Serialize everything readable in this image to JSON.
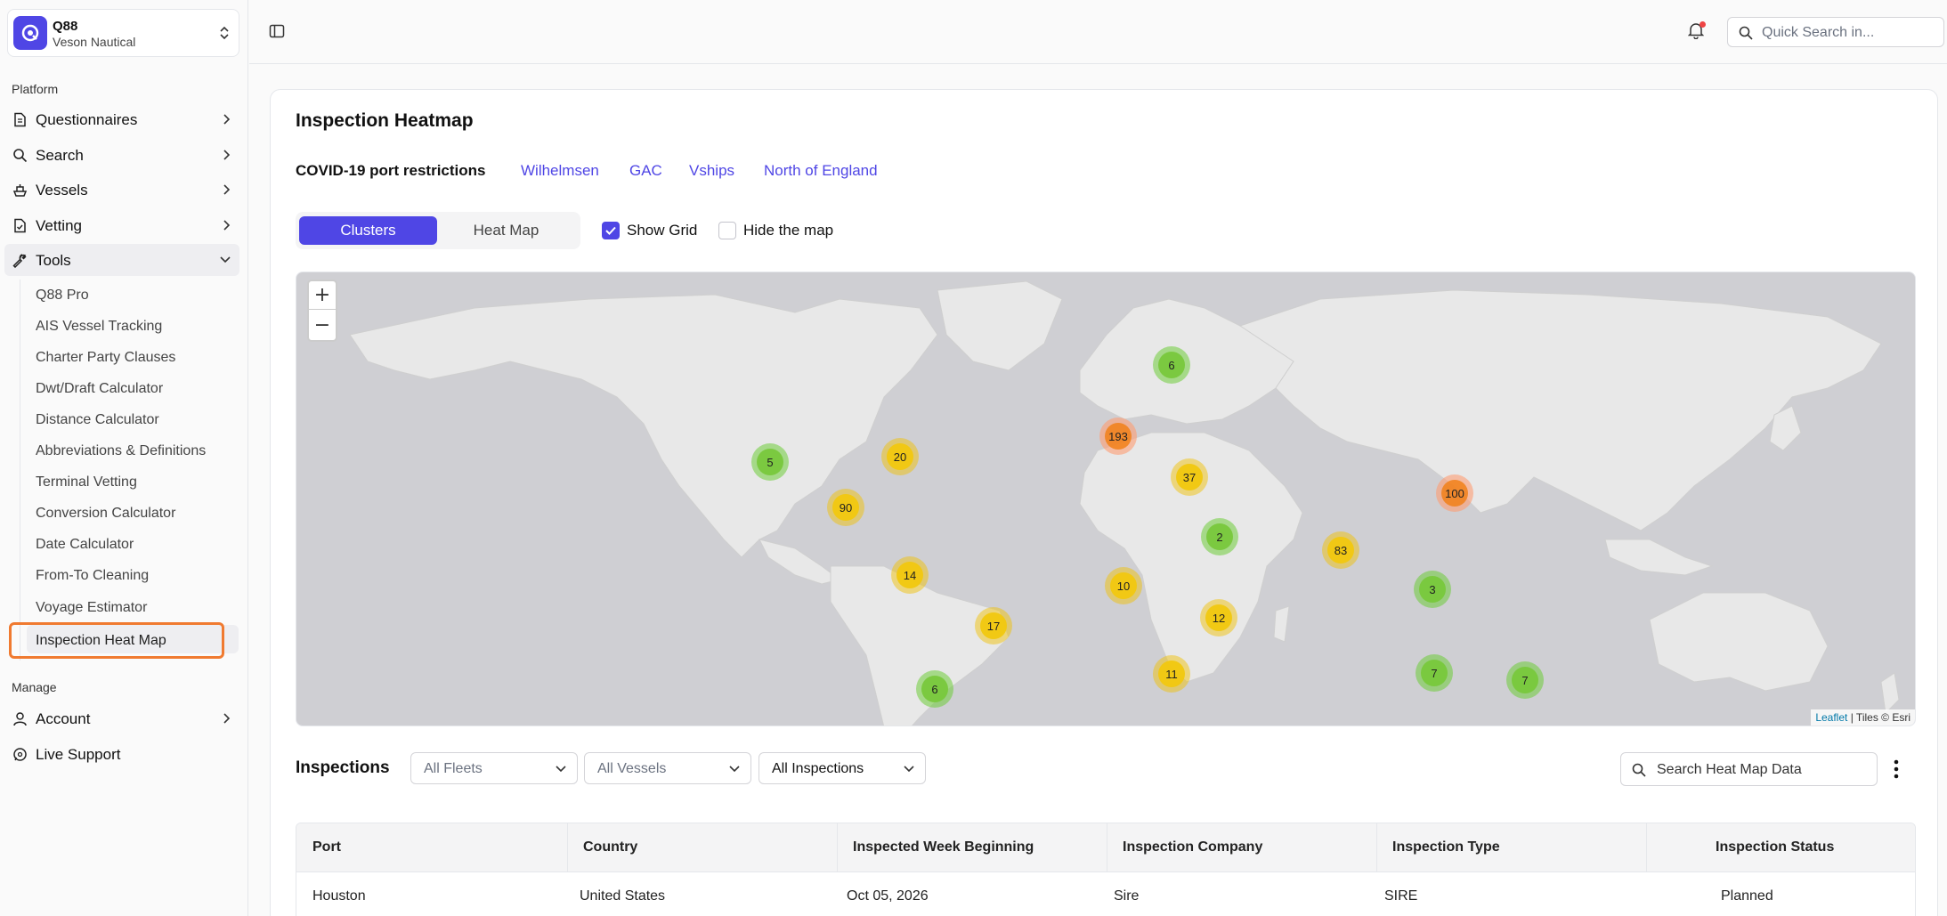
{
  "org": {
    "name": "Q88",
    "subtitle": "Veson Nautical"
  },
  "sidebar": {
    "platform_label": "Platform",
    "manage_label": "Manage",
    "platform_items": [
      {
        "label": "Questionnaires",
        "icon": "document-icon"
      },
      {
        "label": "Search",
        "icon": "search-icon"
      },
      {
        "label": "Vessels",
        "icon": "ship-icon"
      },
      {
        "label": "Vetting",
        "icon": "checklist-icon"
      },
      {
        "label": "Tools",
        "icon": "wrench-icon",
        "expanded": true
      }
    ],
    "tools_items": [
      "Q88 Pro",
      "AIS Vessel Tracking",
      "Charter Party Clauses",
      "Dwt/Draft Calculator",
      "Distance Calculator",
      "Abbreviations & Definitions",
      "Terminal Vetting",
      "Conversion Calculator",
      "Date Calculator",
      "From-To Cleaning",
      "Voyage Estimator",
      "Inspection Heat Map"
    ],
    "active_tool": "Inspection Heat Map",
    "manage_items": [
      {
        "label": "Account",
        "icon": "user-icon"
      },
      {
        "label": "Live Support",
        "icon": "chat-icon"
      }
    ]
  },
  "topbar": {
    "search_placeholder": "Quick Search in..."
  },
  "page": {
    "title": "Inspection Heatmap",
    "covid_label": "COVID-19 port restrictions",
    "covid_links": [
      "Wilhelmsen",
      "GAC",
      "Vships",
      "North of England"
    ],
    "view_toggle": [
      "Clusters",
      "Heat Map"
    ],
    "active_view": "Clusters",
    "show_grid_label": "Show Grid",
    "show_grid_checked": true,
    "hide_map_label": "Hide the map",
    "hide_map_checked": false
  },
  "map": {
    "zoom_in": "+",
    "zoom_out": "−",
    "attribution_leaflet": "Leaflet",
    "attribution_tiles": " | Tiles © Esri",
    "clusters": [
      {
        "count": "6",
        "size": "small",
        "region": "Scandinavia"
      },
      {
        "count": "193",
        "size": "large",
        "region": "Western Europe"
      },
      {
        "count": "5",
        "size": "small",
        "region": "US West Coast"
      },
      {
        "count": "20",
        "size": "medium",
        "region": "US East Coast"
      },
      {
        "count": "90",
        "size": "medium",
        "region": "US Gulf"
      },
      {
        "count": "37",
        "size": "medium",
        "region": "Eastern Mediterranean"
      },
      {
        "count": "100",
        "size": "large",
        "region": "East Asia"
      },
      {
        "count": "2",
        "size": "small",
        "region": "Arabian Peninsula"
      },
      {
        "count": "83",
        "size": "medium",
        "region": "India"
      },
      {
        "count": "14",
        "size": "medium",
        "region": "Caribbean"
      },
      {
        "count": "10",
        "size": "medium",
        "region": "West Africa"
      },
      {
        "count": "3",
        "size": "small",
        "region": "Southeast Asia"
      },
      {
        "count": "17",
        "size": "medium",
        "region": "Brazil"
      },
      {
        "count": "12",
        "size": "medium",
        "region": "East Africa"
      },
      {
        "count": "11",
        "size": "medium",
        "region": "South Africa"
      },
      {
        "count": "7",
        "size": "small",
        "region": "Western Australia"
      },
      {
        "count": "7",
        "size": "small",
        "region": "Eastern Australia"
      },
      {
        "count": "6",
        "size": "small",
        "region": "South America South"
      }
    ]
  },
  "inspections": {
    "title": "Inspections",
    "filters": [
      "All Fleets",
      "All Vessels",
      "All Inspections"
    ],
    "search_placeholder": "Search Heat Map Data",
    "columns": [
      "Port",
      "Country",
      "Inspected Week Beginning",
      "Inspection Company",
      "Inspection Type",
      "Inspection Status"
    ],
    "rows": [
      [
        "Houston",
        "United States",
        "Oct 05, 2026",
        "Sire",
        "SIRE",
        "Planned"
      ]
    ]
  },
  "colors": {
    "accent": "#4f46e5",
    "highlight": "#f07a30",
    "cluster_small": "#78c83c",
    "cluster_medium": "#f1c80f",
    "cluster_large": "#f18017"
  }
}
